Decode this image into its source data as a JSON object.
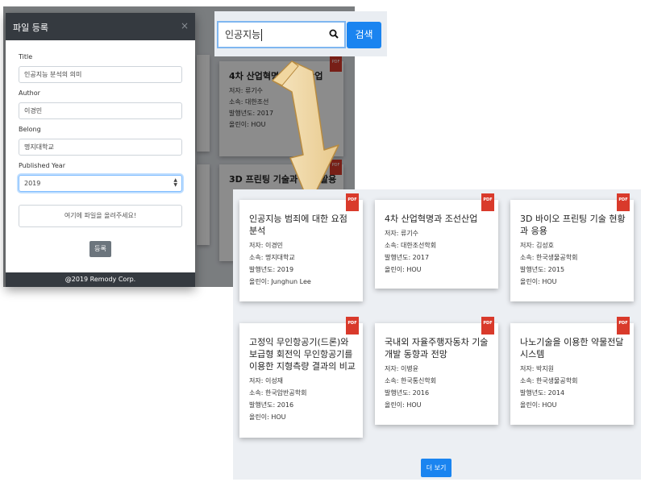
{
  "modal": {
    "title": "파일 등록",
    "close": "×",
    "fields": {
      "title_label": "Title",
      "title_value": "인공지능 분석의 의미",
      "author_label": "Author",
      "author_value": "이경민",
      "belong_label": "Belong",
      "belong_value": "명지대학교",
      "year_label": "Published Year",
      "year_value": "2019"
    },
    "upload_text": "여기에 파일을 올려주세요!",
    "submit_label": "등록",
    "footer": "@2019 Remody Corp."
  },
  "search": {
    "query": "인공지능",
    "button_label": "검색"
  },
  "background_cards": [
    {
      "title": "4차 산업혁명과 조선산업",
      "author": "저자: 류기수",
      "belong": "소속: 대한조선",
      "year": "발행년도: 2017",
      "uploader": "올린이: HOU"
    },
    {
      "title": "3D 프린팅 기술과 전망 활용",
      "author": "",
      "belong": "",
      "year": "",
      "uploader": ""
    }
  ],
  "cards": [
    {
      "title": "인공지능 범죄에 대한 요점 분석",
      "author": "저자: 이경민",
      "belong": "소속: 명지대학교",
      "year": "발행년도: 2019",
      "uploader": "올린이: Junghun Lee"
    },
    {
      "title": "4차 산업혁명과 조선산업",
      "author": "저자: 류기수",
      "belong": "소속: 대한조선학회",
      "year": "발행년도: 2017",
      "uploader": "올린이: HOU"
    },
    {
      "title": "3D 바이오 프린팅 기술 현황과 응용",
      "author": "저자: 김성호",
      "belong": "소속: 한국생물공학회",
      "year": "발행년도: 2015",
      "uploader": "올린이: HOU"
    },
    {
      "title": "고정익 무인항공기(드론)와 보급형 회전익 무인항공기를 이용한 지형측량 결과의 비교",
      "author": "저자: 이성재",
      "belong": "소속: 한국암반공학회",
      "year": "발행년도: 2016",
      "uploader": "올린이: HOU"
    },
    {
      "title": "국내외 자율주행자동차 기술 개발 동향과 전망",
      "author": "저자: 이병윤",
      "belong": "소속: 한국통신학회",
      "year": "발행년도: 2016",
      "uploader": "올린이: HOU"
    },
    {
      "title": "나노기술을 이용한 약물전달 시스템",
      "author": "저자: 박지원",
      "belong": "소속: 한국생물공학회",
      "year": "발행년도: 2014",
      "uploader": "올린이: HOU"
    }
  ],
  "pdf_badge": "PDF",
  "more_label": "더 보기",
  "colors": {
    "primary": "#1a84f0",
    "modal_header": "#353a40",
    "pdf_badge": "#d93a2b",
    "arrow_fill": "#f2d9a5",
    "panel_bg": "#eceff3"
  },
  "icons": {
    "search": "search-icon",
    "close": "close-icon",
    "pdf": "pdf-icon",
    "arrow": "down-arrow-icon"
  }
}
